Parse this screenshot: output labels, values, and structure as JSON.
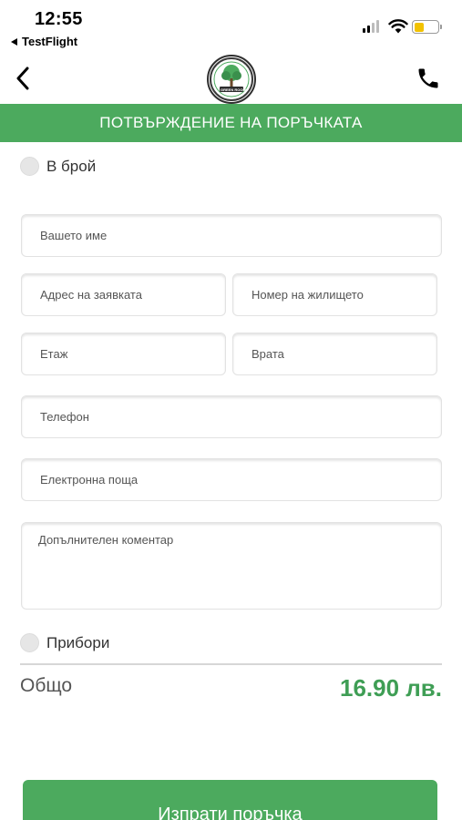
{
  "status_bar": {
    "time": "12:55",
    "back_app": "TestFlight",
    "battery_color": "#f2c200"
  },
  "nav": {
    "back_icon": "chevron-left-icon",
    "logo_text": "GREEN ROOM",
    "phone_icon": "phone-icon"
  },
  "header": {
    "title": "ПОТВЪРЖДЕНИЕ НА ПОРЪЧКАТА",
    "background": "#4caa5e"
  },
  "payment": {
    "cash_label": "В брой"
  },
  "form": {
    "name_placeholder": "Вашето име",
    "address_placeholder": "Адрес на заявката",
    "house_number_placeholder": "Номер на жилището",
    "floor_placeholder": "Етаж",
    "door_placeholder": "Врата",
    "phone_placeholder": "Телефон",
    "email_placeholder": "Електронна поща",
    "comment_placeholder": "Допълнителен коментар"
  },
  "cutlery": {
    "label": "Прибори"
  },
  "total": {
    "label": "Общо",
    "value": "16.90 лв.",
    "color": "#3f9e55"
  },
  "submit": {
    "label": "Изпрати поръчка"
  }
}
